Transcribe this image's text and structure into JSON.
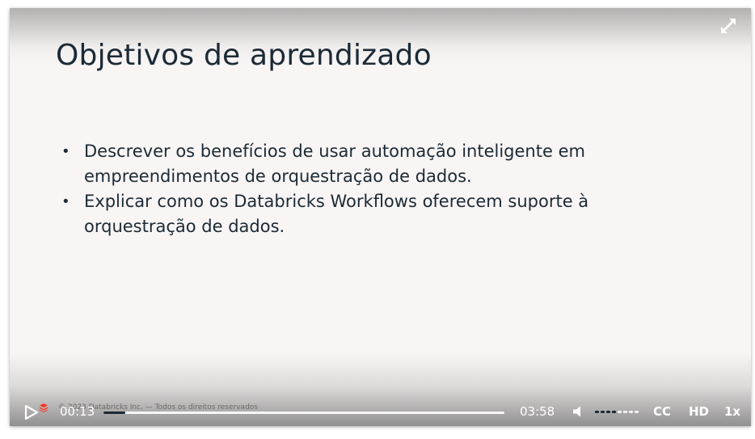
{
  "slide": {
    "title": "Objetivos de aprendizado",
    "bullets": [
      "Descrever os benefícios de usar automação inteligente em empreendimentos de orquestração de dados.",
      "Explicar como os Databricks Workflows oferecem suporte à orquestração de dados."
    ],
    "footer": "© 2023 Databricks Inc. — Todos os direitos reservados"
  },
  "player": {
    "current_time": "00:13",
    "total_time": "03:58",
    "progress_fraction": 0.055,
    "volume_fraction": 0.55,
    "cc_label": "CC",
    "hd_label": "HD",
    "rate_label": "1x",
    "icons": {
      "play": "play-icon",
      "volume": "volume-icon",
      "expand": "expand-icon",
      "logo": "databricks-logo-icon"
    }
  },
  "colors": {
    "slide_bg": "#f8f5f4",
    "text": "#1b2a36",
    "brand": "#ff3621"
  }
}
